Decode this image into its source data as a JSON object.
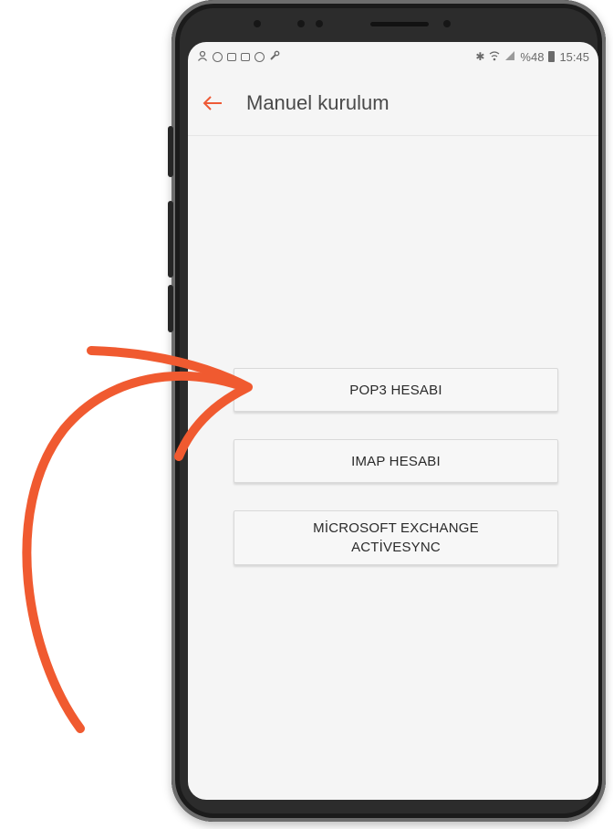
{
  "status_bar": {
    "battery": "%48",
    "time": "15:45",
    "left_icons": [
      "person-icon",
      "circle-p-icon",
      "image-icon",
      "email-icon",
      "circle-icon",
      "wrench-icon"
    ],
    "right_icons": [
      "bluetooth-icon",
      "wifi-icon",
      "signal-icon",
      "battery-icon"
    ]
  },
  "app_bar": {
    "title": "Manuel kurulum",
    "back_icon": "arrow-left-icon"
  },
  "account_options": {
    "pop3_label": "POP3 HESABI",
    "imap_label": "IMAP HESABI",
    "exchange_line1": "MİCROSOFT EXCHANGE",
    "exchange_line2": "ACTİVESYNC"
  },
  "colors": {
    "accent": "#ee5a36",
    "arrow": "#f05a30",
    "screen_bg": "#f5f5f5",
    "frame": "#2c2c2c"
  }
}
